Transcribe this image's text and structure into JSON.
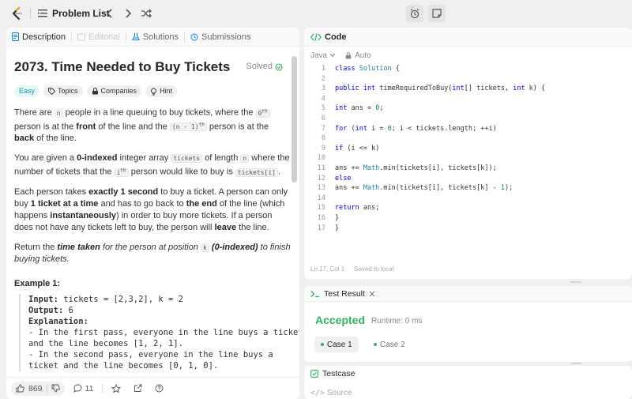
{
  "topbar": {
    "problem_list_label": "Problem List",
    "prev_icon": "chevron-left-icon",
    "next_icon": "chevron-right-icon",
    "shuffle_icon": "shuffle-icon"
  },
  "left_tabs": [
    {
      "label": "Description",
      "active": true
    },
    {
      "label": "Editorial",
      "disabled": true
    },
    {
      "label": "Solutions"
    },
    {
      "label": "Submissions"
    }
  ],
  "problem": {
    "title": "2073. Time Needed to Buy Tickets",
    "status": "Solved",
    "tags": [
      "Easy",
      "Topics",
      "Companies",
      "Hint"
    ],
    "p1": {
      "a": "There are ",
      "n": "n",
      "b": " people in a line queuing to buy tickets, where the ",
      "zeroth": "0",
      "th": "th",
      "c": " person is at the ",
      "front": "front",
      "d": " of the line and the ",
      "nminus": "(n - 1)",
      "th2": "th",
      "e": " person is at the ",
      "back": "back",
      "f": " of the line."
    },
    "p2": {
      "a": "You are given a ",
      "zero_indexed": "0-indexed",
      "b": " integer array ",
      "tickets": "tickets",
      "c": " of length ",
      "n": "n",
      "d": " where the number of tickets that the ",
      "ith": "i",
      "th": "th",
      "e": " person would like to buy is ",
      "ticketsi": "tickets[i]",
      "f": "."
    },
    "p3": {
      "a": "Each person takes ",
      "exactly": "exactly 1 second",
      "b": " to buy a ticket. A person can only buy ",
      "one": "1 ticket at a time",
      "c": " and has to go back to ",
      "end": "the end",
      "d": " of the line (which happens ",
      "inst": "instantaneously",
      "e": ") in order to buy more tickets. If a person does not have any tickets left to buy, the person will ",
      "leave": "leave",
      "f": " the line."
    },
    "p4": {
      "a": "Return the ",
      "time_taken": "time taken",
      "b": " for the person at position ",
      "k": "k",
      "c": " (0-indexed)",
      "d": " to finish buying tickets."
    },
    "example_heading": "Example 1:",
    "example_lines": [
      {
        "key": "Input:",
        "val": " tickets = [2,3,2], k = 2"
      },
      {
        "key": "Output:",
        "val": " 6"
      },
      {
        "key": "Explanation:",
        "val": ""
      },
      {
        "key": "",
        "val": "- In the first pass, everyone in the line buys a ticket"
      },
      {
        "key": "",
        "val": "and the line becomes [1, 2, 1]."
      },
      {
        "key": "",
        "val": "- In the second pass, everyone in the line buys a"
      },
      {
        "key": "",
        "val": "ticket and the line becomes [0, 1, 0]."
      }
    ]
  },
  "footer": {
    "likes": "869",
    "comments": "11"
  },
  "code_panel": {
    "title": "Code",
    "language": "Java",
    "mode": "Auto",
    "status_pos": "Ln 17, Col 1",
    "status_saved": "Saved to local",
    "lines": [
      "class Solution {",
      "",
      "public int timeRequiredToBuy(int[] tickets, int k) {",
      "",
      "int ans = 0;",
      "",
      "for (int i = 0; i < tickets.length; ++i)",
      "",
      "if (i <= k)",
      "",
      "ans += Math.min(tickets[i], tickets[k]);",
      "else",
      "ans += Math.min(tickets[i], tickets[k] - 1);",
      "",
      "return ans;",
      "}",
      "}"
    ]
  },
  "test_result": {
    "title": "Test Result",
    "verdict": "Accepted",
    "runtime": "Runtime: 0 ms",
    "cases": [
      "Case 1",
      "Case 2"
    ]
  },
  "testcase": {
    "title": "Testcase",
    "source": "Source"
  },
  "colors": {
    "accent_green": "#2db55d",
    "easy_teal": "#00a2a8",
    "logo_orange": "#ffa116"
  }
}
